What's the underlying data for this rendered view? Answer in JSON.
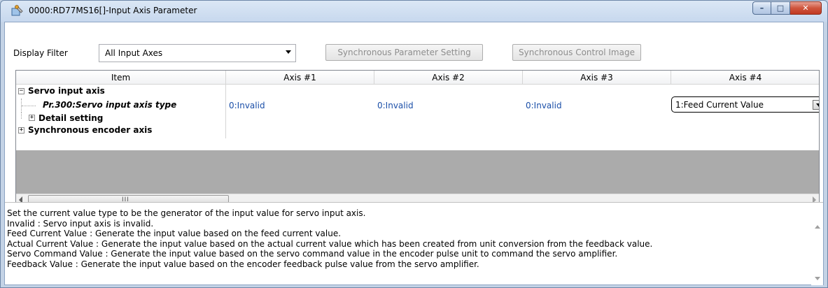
{
  "window": {
    "title": "0000:RD77MS16[]-Input Axis Parameter",
    "controls": {
      "minimize": "–",
      "maximize": "□",
      "close": "✕"
    }
  },
  "toolbar": {
    "filter_label": "Display Filter",
    "filter_value": "All Input Axes",
    "sync_param_button": "Synchronous Parameter Setting",
    "sync_image_button": "Synchronous Control Image"
  },
  "grid": {
    "headers": [
      "Item",
      "Axis #1",
      "Axis #2",
      "Axis #3",
      "Axis #4"
    ],
    "rows": [
      {
        "label": "Servo input axis",
        "expander": "−",
        "values": [
          "",
          "",
          "",
          ""
        ]
      },
      {
        "label": "Pr.300:Servo input axis type",
        "values": [
          "0:Invalid",
          "0:Invalid",
          "0:Invalid",
          "1:Feed Current Value"
        ]
      },
      {
        "label": "Detail setting",
        "expander": "+",
        "values": [
          "",
          "",
          "",
          ""
        ]
      },
      {
        "label": "Synchronous encoder axis",
        "expander": "+",
        "values": [
          "",
          "",
          "",
          ""
        ]
      }
    ],
    "scroll_grip": "III"
  },
  "description": {
    "lines": [
      "Set the current value type to be the generator of the input value for servo input axis.",
      "Invalid : Servo input axis is invalid.",
      "Feed Current Value : Generate the input value based on the feed current value.",
      "Actual Current Value : Generate the input value based on the actual current value which has been created from unit conversion from the feedback value.",
      "Servo Command Value : Generate the input value based on the servo command value in the encoder pulse unit to command the servo amplifier.",
      "Feedback Value : Generate the input value based on the encoder feedback pulse value from the servo amplifier."
    ]
  },
  "icons": {
    "window_icon": "app-wrench-icon",
    "filter_dropdown": "chevron-down-icon"
  }
}
